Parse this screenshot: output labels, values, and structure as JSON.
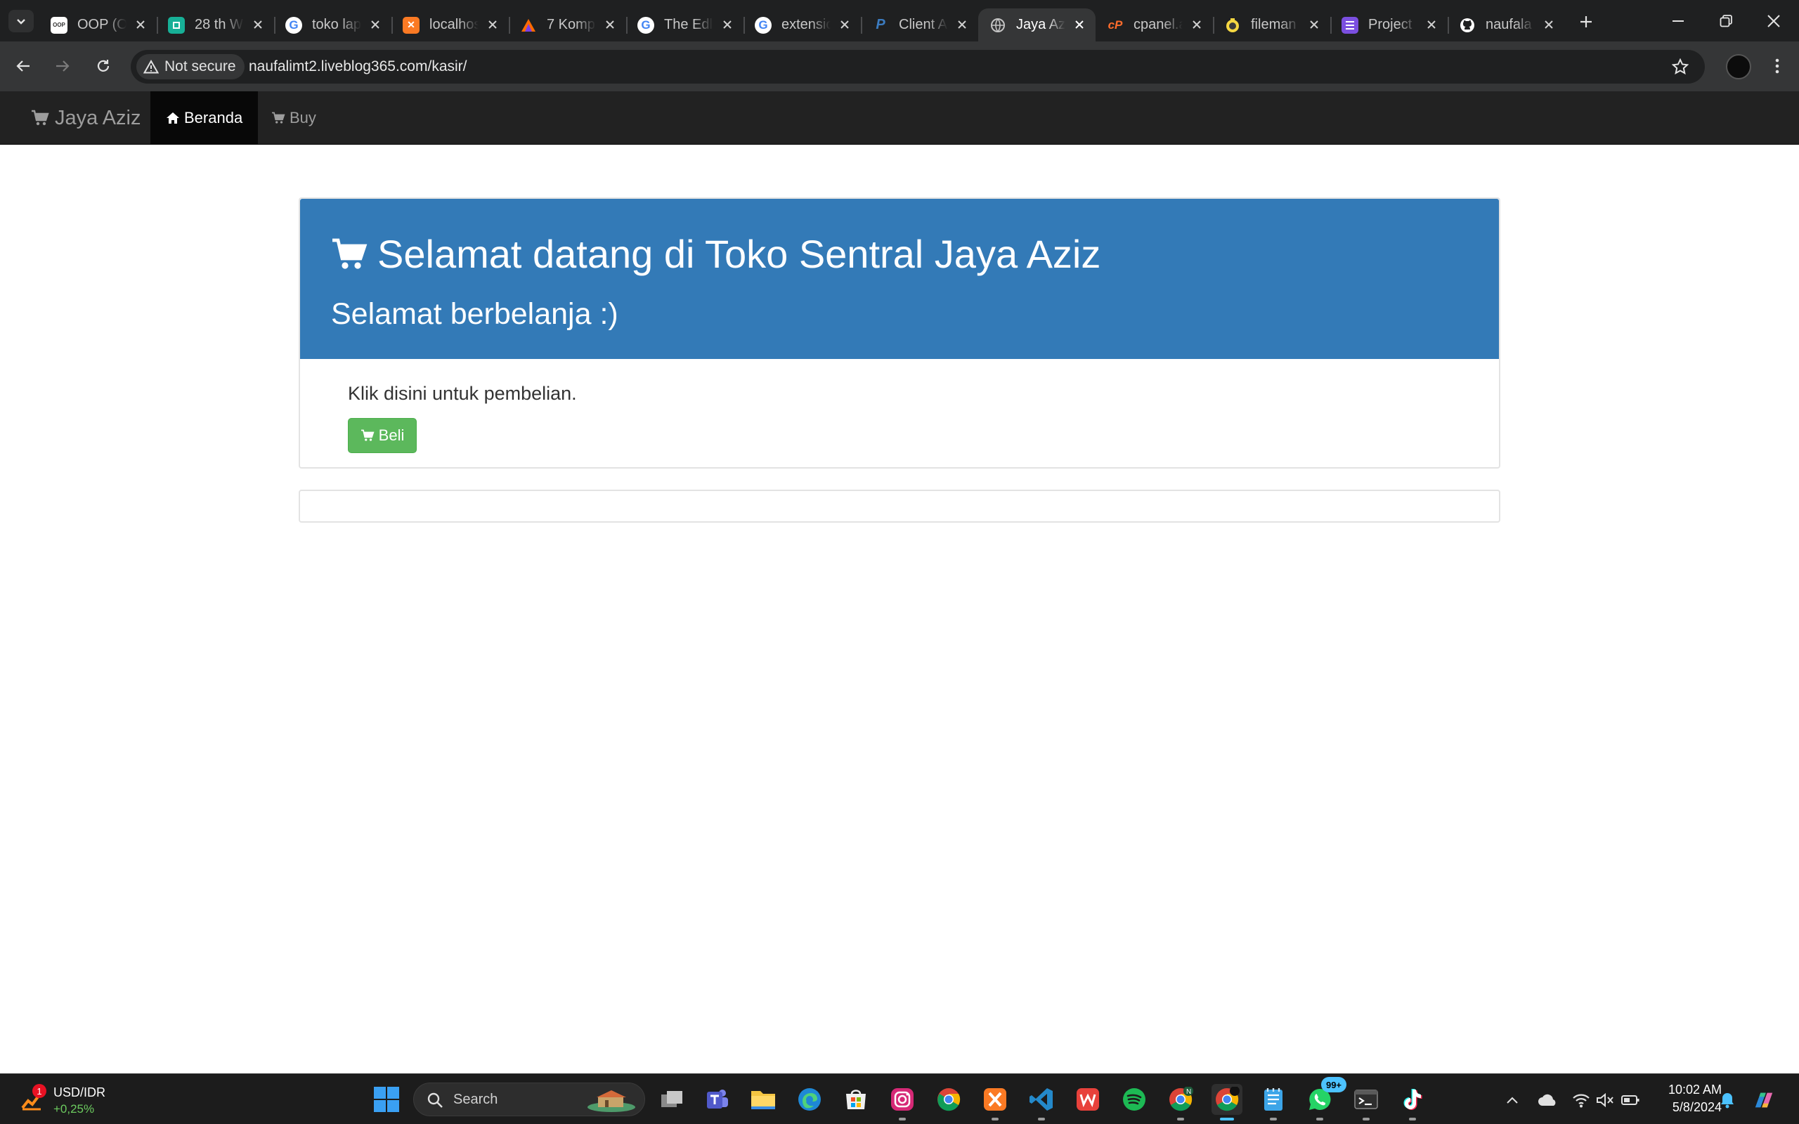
{
  "browser": {
    "tabs": [
      {
        "title": "OOP (O",
        "favicon": "oop-page-icon",
        "color": "#ffffff"
      },
      {
        "title": "28 th W",
        "favicon": "square-app-icon",
        "color": "#17b097"
      },
      {
        "title": "toko lap",
        "favicon": "google-icon",
        "color": "#ffffff"
      },
      {
        "title": "localhos",
        "favicon": "xampp-icon",
        "color": "#fb7a24"
      },
      {
        "title": "7 Komp",
        "favicon": "triangle-logo-icon",
        "color": "#ff6a00"
      },
      {
        "title": "The Edl",
        "favicon": "google-icon",
        "color": "#ffffff"
      },
      {
        "title": "extensio",
        "favicon": "google-icon",
        "color": "#ffffff"
      },
      {
        "title": "Client A",
        "favicon": "paypal-icon",
        "color": "#3b7bbf"
      },
      {
        "title": "Jaya Az",
        "favicon": "globe-icon",
        "color": "#c4c4c4",
        "active": true
      },
      {
        "title": "cpanel.a",
        "favicon": "cpanel-icon",
        "color": "#ff6c2c"
      },
      {
        "title": "fileman",
        "favicon": "filemanager-icon",
        "color": "#f5d742"
      },
      {
        "title": "Project",
        "favicon": "list-app-icon",
        "color": "#7b4fe0"
      },
      {
        "title": "naufala",
        "favicon": "github-icon",
        "color": "#ffffff"
      }
    ],
    "security_label": "Not secure",
    "url": "naufalimt2.liveblog365.com/kasir/"
  },
  "site": {
    "brand": "Jaya Aziz",
    "nav": {
      "home": "Beranda",
      "buy": "Buy"
    },
    "jumbotron": {
      "title": "Selamat datang di Toko Sentral Jaya Aziz",
      "subtitle": "Selamat berbelanja :)"
    },
    "prompt_text": "Klik disini untuk pembelian.",
    "buy_button": "Beli"
  },
  "taskbar": {
    "widget": {
      "title": "USD/IDR",
      "value": "+0,25%",
      "badge": "1"
    },
    "search_placeholder": "Search",
    "apps": [
      "task-view-icon",
      "teams-icon",
      "file-explorer-icon",
      "edge-icon",
      "microsoft-store-icon",
      "instagram-icon",
      "chrome-icon",
      "xampp-icon",
      "vscode-icon",
      "wps-office-icon",
      "spotify-icon",
      "chrome-profile-icon",
      "chrome-active-icon",
      "notepad-icon",
      "whatsapp-icon",
      "terminal-icon",
      "tiktok-icon"
    ],
    "whatsapp_badge": "99+",
    "clock_time": "10:02 AM",
    "clock_date": "5/8/2024"
  },
  "colors": {
    "jumbotron_bg": "#337ab7",
    "button_success": "#5cb85c",
    "navbar_bg": "#222222",
    "navbar_active": "#080808"
  }
}
